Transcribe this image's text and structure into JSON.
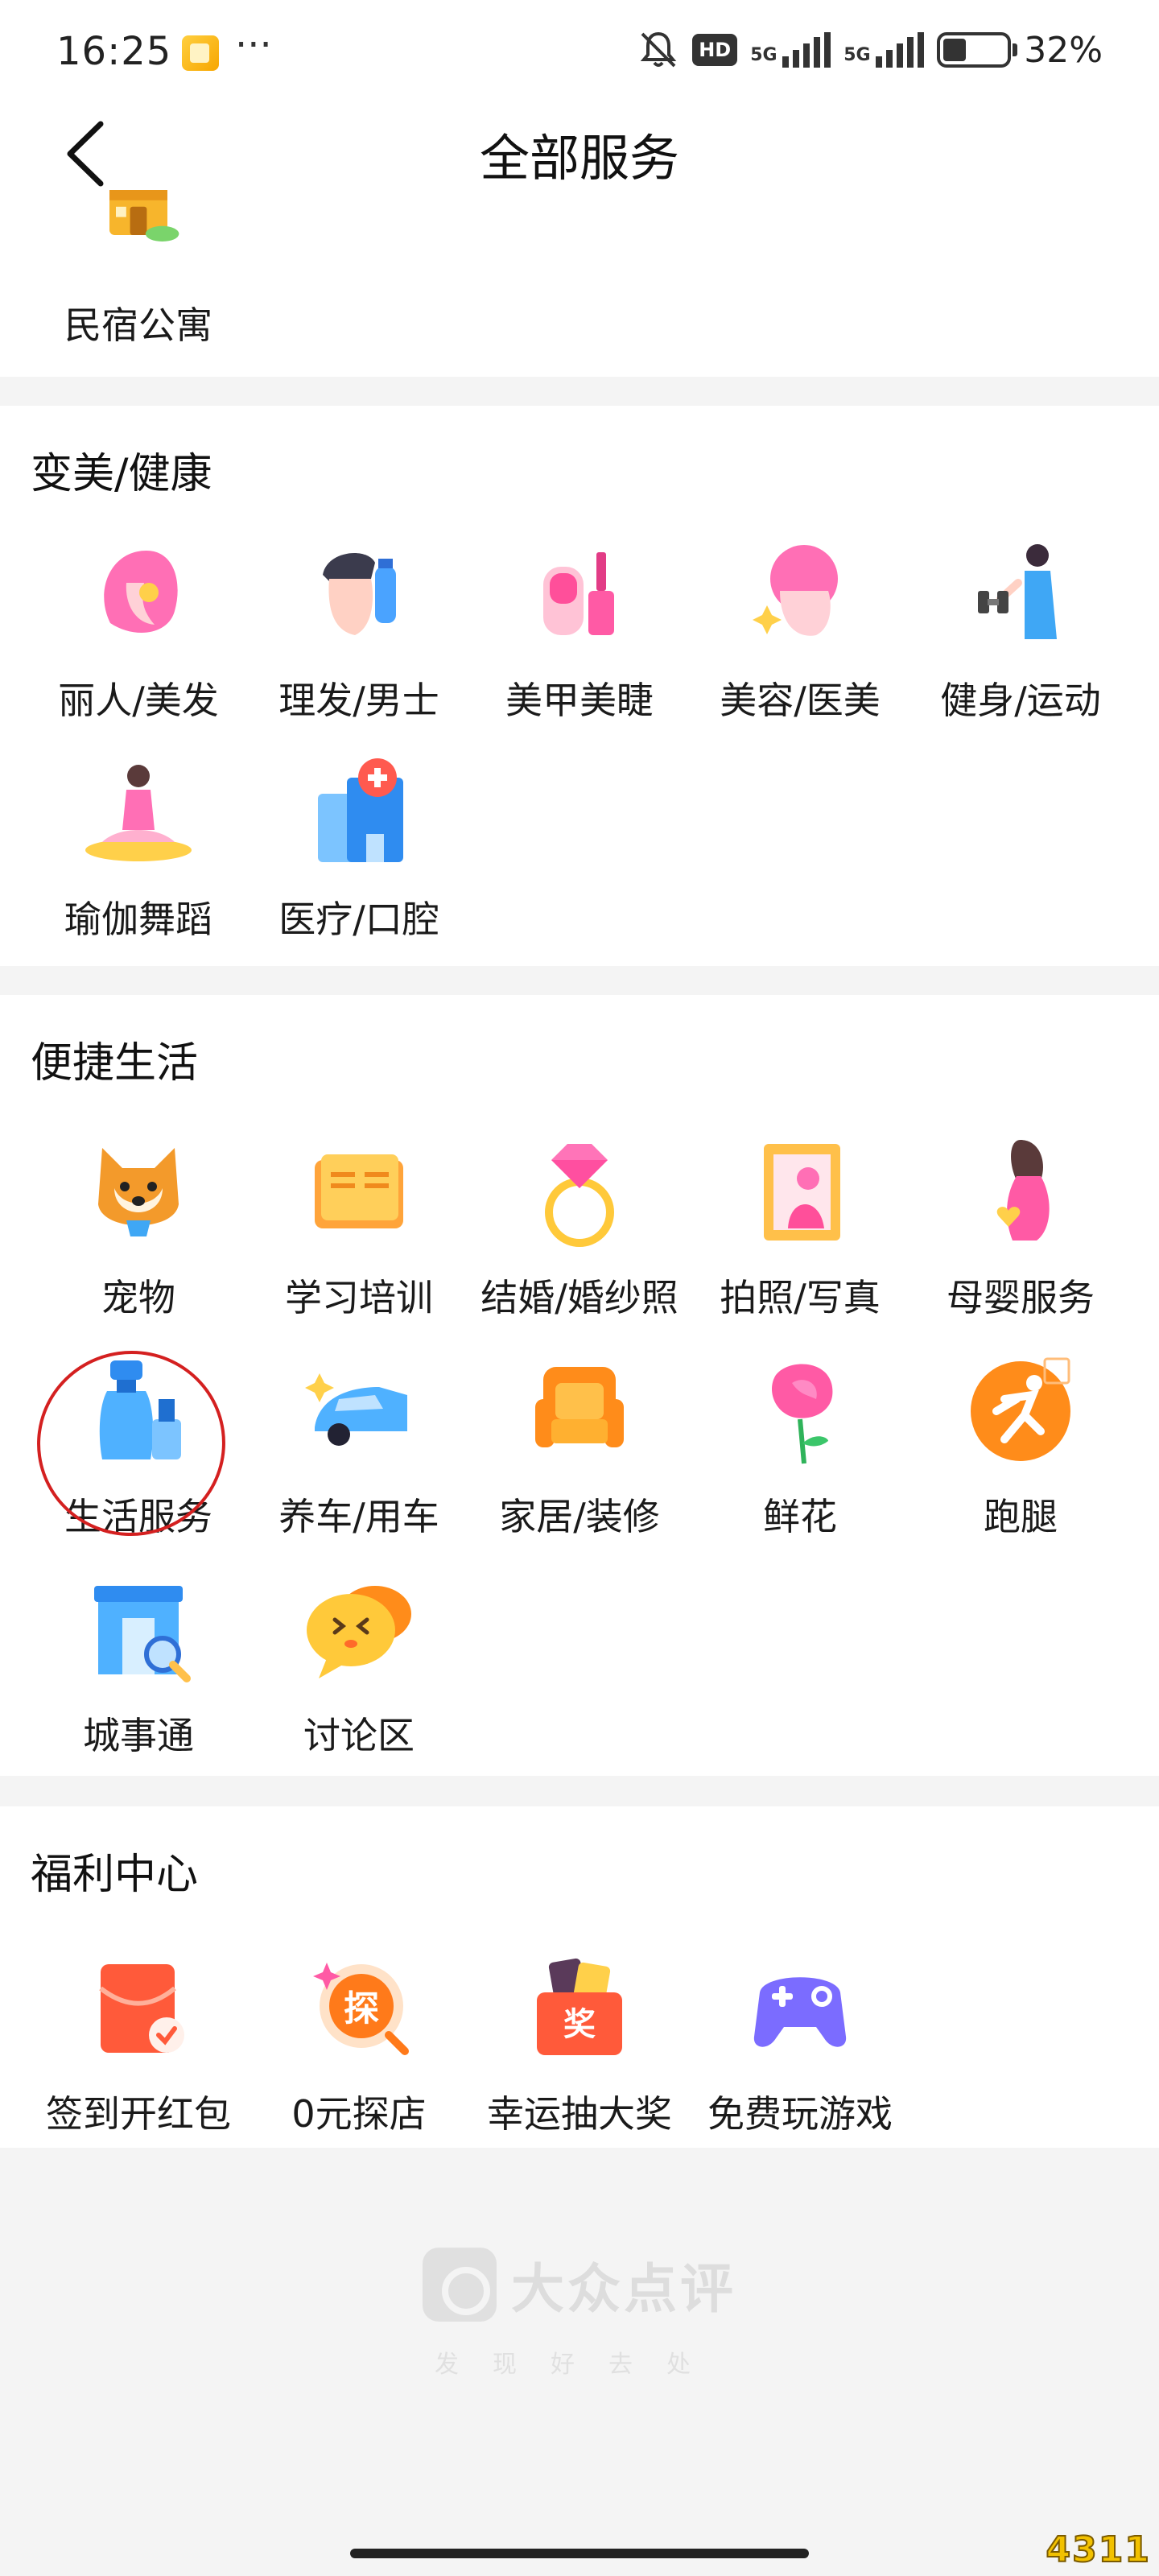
{
  "status_bar": {
    "time": "16:25",
    "more": "···",
    "hd": "HD",
    "sig1": "5G",
    "sig2": "5G",
    "battery": "32%"
  },
  "header": {
    "title": "全部服务"
  },
  "sections": {
    "top": {
      "items": [
        "民宿公寓"
      ]
    },
    "beauty": {
      "title": "变美/健康",
      "items": [
        "丽人/美发",
        "理发/男士",
        "美甲美睫",
        "美容/医美",
        "健身/运动",
        "瑜伽舞蹈",
        "医疗/口腔"
      ]
    },
    "life": {
      "title": "便捷生活",
      "items": [
        "宠物",
        "学习培训",
        "结婚/婚纱照",
        "拍照/写真",
        "母婴服务",
        "生活服务",
        "养车/用车",
        "家居/装修",
        "鲜花",
        "跑腿",
        "城事通",
        "讨论区"
      ]
    },
    "welfare": {
      "title": "福利中心",
      "items": [
        "签到开红包",
        "0元探店",
        "幸运抽大奖",
        "免费玩游戏"
      ]
    }
  },
  "footer": {
    "brand": "大众点评",
    "slogan": "发现好去处"
  },
  "watermark": "4311",
  "icons": {
    "top": [
      "house-icon"
    ],
    "beauty": [
      "woman-hair-icon",
      "man-hair-icon",
      "nail-polish-icon",
      "facial-icon",
      "dumbbell-icon",
      "yoga-icon",
      "medical-icon"
    ],
    "life": [
      "shiba-dog-icon",
      "book-icon",
      "diamond-ring-icon",
      "photo-frame-icon",
      "pregnant-icon",
      "spray-bottle-icon",
      "car-icon",
      "armchair-icon",
      "rose-icon",
      "runner-icon",
      "storefront-icon",
      "chat-bubble-icon"
    ],
    "welfare": [
      "red-envelope-icon",
      "explore-store-icon",
      "prize-box-icon",
      "gamepad-icon"
    ]
  }
}
